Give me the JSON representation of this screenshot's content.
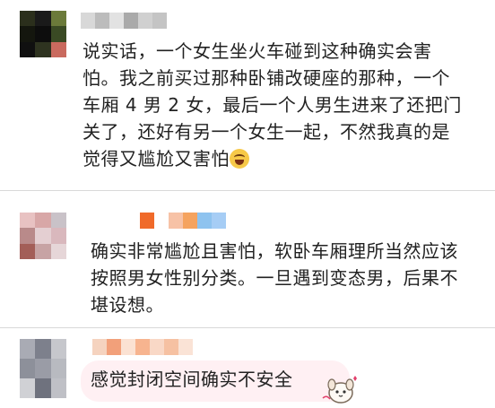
{
  "comments": [
    {
      "text": "说实话，一个女生坐火车碰到这种确实会害\n怕。我之前买过那种卧铺改硬座的那种，一个\n车厢 4 男 2 女，最后一个人男生进来了还把门\n关了，还好有另一个女生一起，不然我真的是\n觉得又尴尬又害怕",
      "emoji_icon": "face-with-tears-of-joy-icon",
      "avatar_colors": [
        "#2b2f1c",
        "#1a1a1a",
        "#6b7a3a",
        "#14160e",
        "#0d0d0d",
        "#3a4a24",
        "#101010",
        "#2e3320",
        "#c96a5e"
      ],
      "name_colors": [
        "#d8d8d8",
        "#bcbcbc",
        "#e2e2e2",
        "#aaaaaa",
        "#d0d0d0",
        "#c4c4c4"
      ]
    },
    {
      "text": "确实非常尴尬且害怕，软卧车厢理所当然应该\n按照男女性别分类。一旦遇到变态男，后果不\n堪设想。",
      "avatar_colors": [
        "#e8c2c2",
        "#d8a7a7",
        "#c9c2c8",
        "#b98a8a",
        "#e4cfd2",
        "#d9b8bd",
        "#a35e58",
        "#c7a3a4",
        "#e6d6d8"
      ],
      "name_colors": [
        "#f06a2a",
        "#ffffff",
        "#f7c2a6",
        "#f5a35f",
        "#8ec3ef",
        "#a6cdf5"
      ]
    },
    {
      "text": "感觉封闭空间确实不安全",
      "sticker_icon": "cute-dog-sticker-icon",
      "avatar_colors": [
        "#a9abb4",
        "#7d808c",
        "#c6c7cc",
        "#8d909a",
        "#9a9ca6",
        "#b8bac0",
        "#d0d1d5",
        "#6f727e",
        "#bfc0c6"
      ],
      "name_colors": [
        "#f5d3bf",
        "#f2a07a",
        "#fbe2d3",
        "#f7b48f",
        "#f9d8c6",
        "#f6c1a2",
        "#fae3d6"
      ]
    }
  ]
}
